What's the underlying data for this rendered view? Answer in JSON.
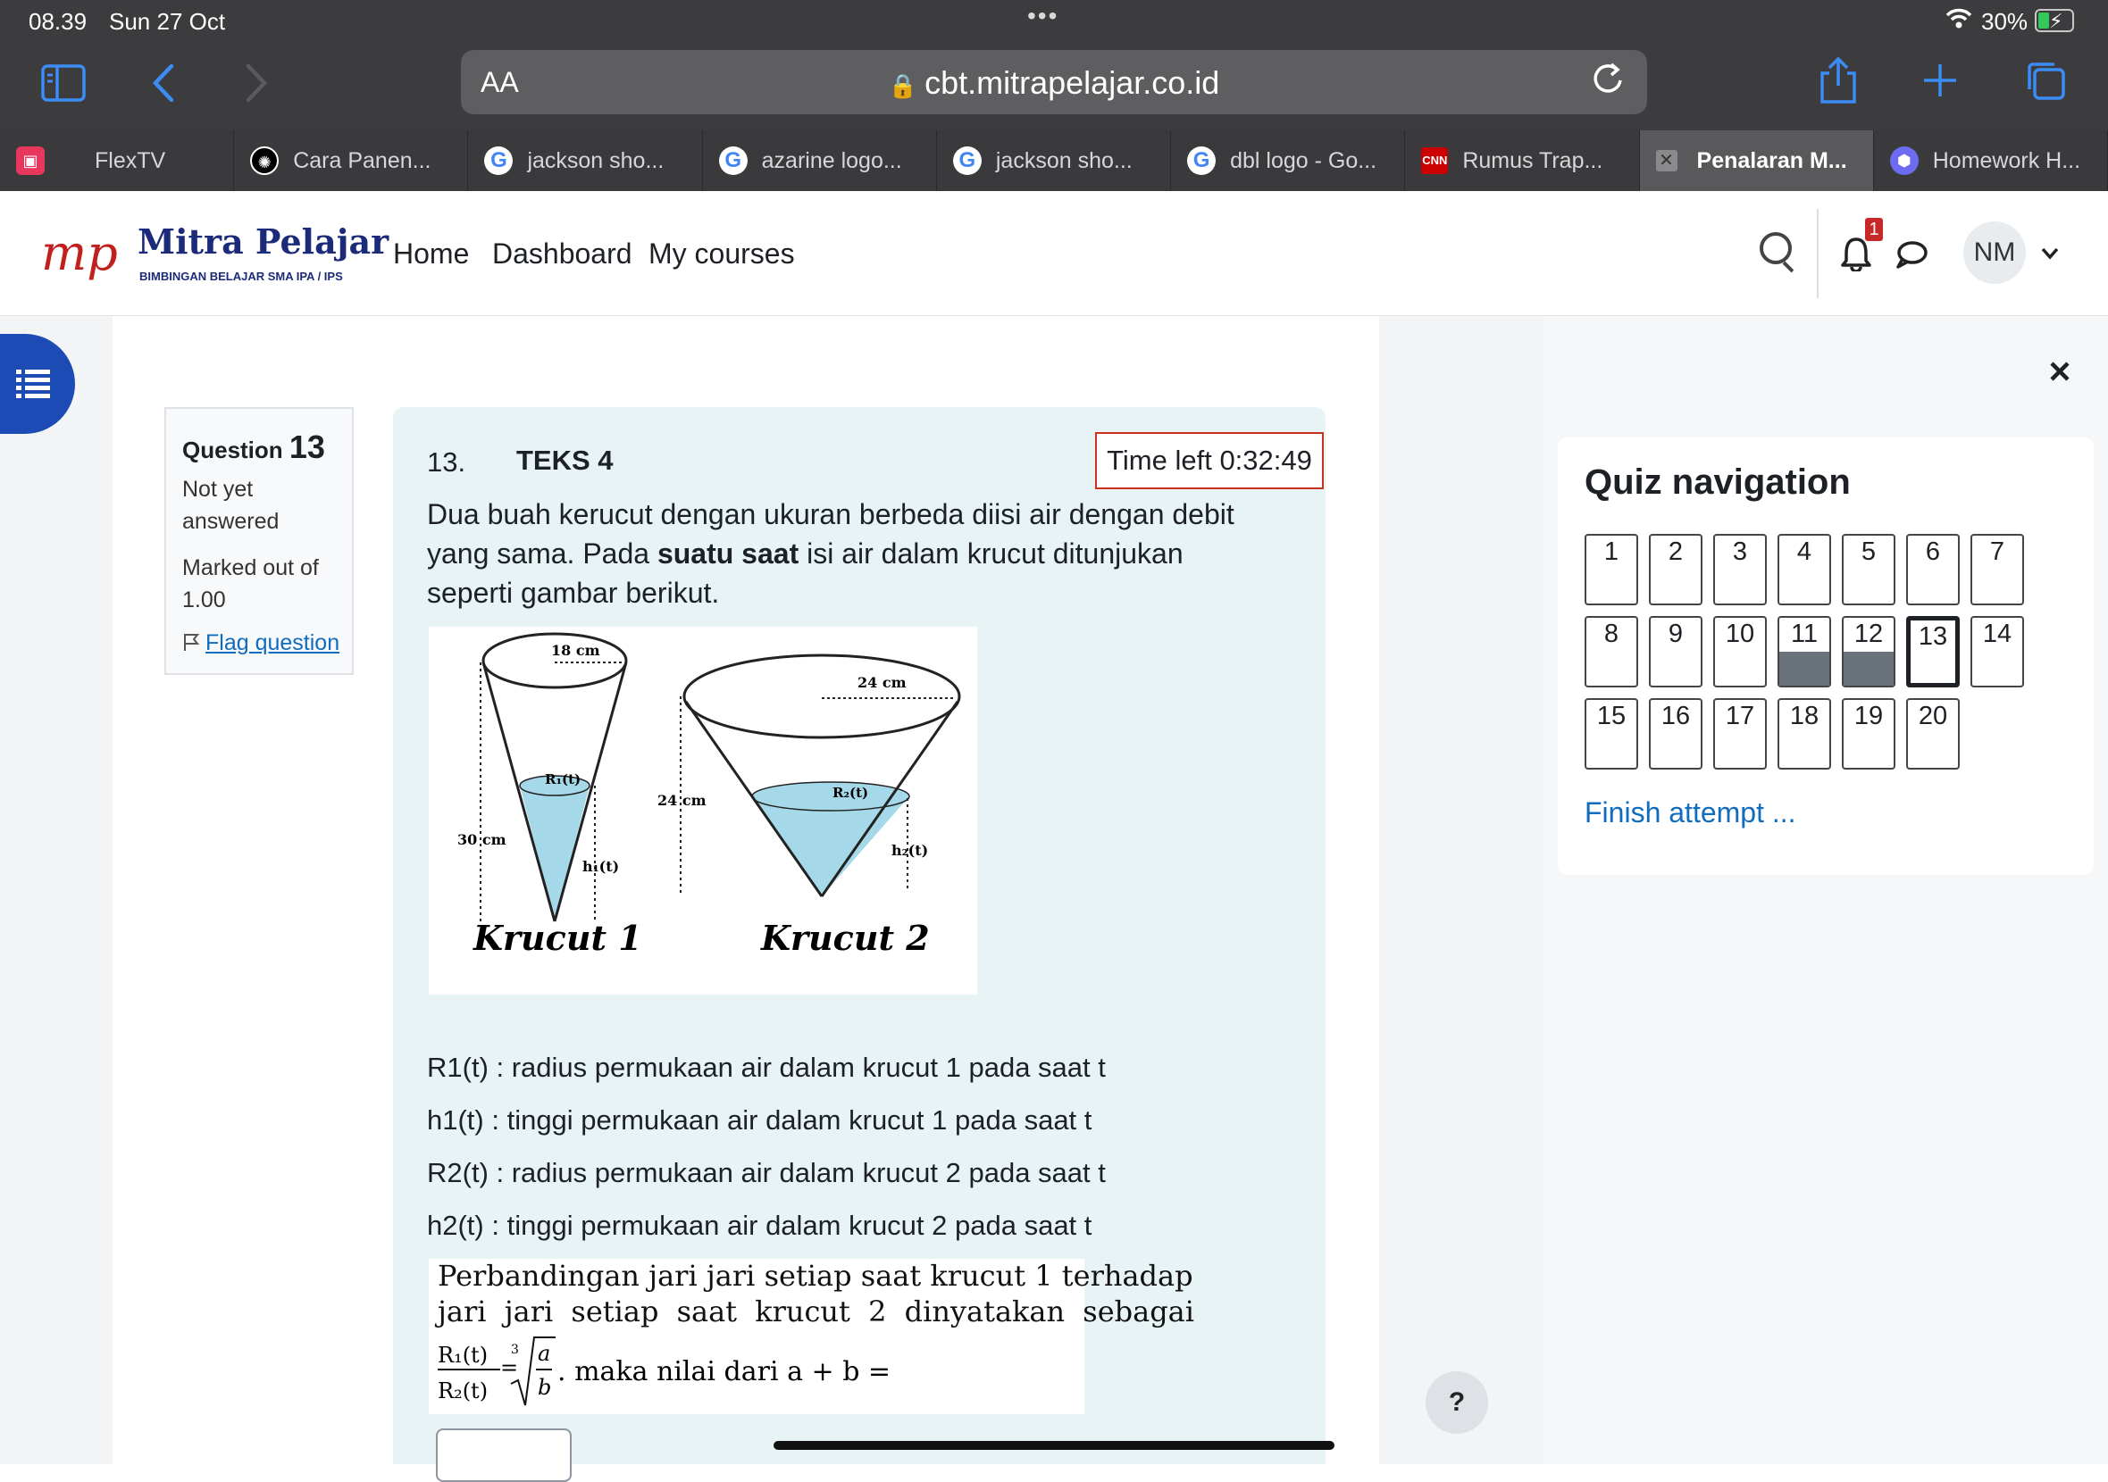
{
  "status_bar": {
    "time": "08.39",
    "date": "Sun 27 Oct",
    "battery": "30%"
  },
  "browser": {
    "text_size_label": "AA",
    "url": "cbt.mitrapelajar.co.id"
  },
  "tabs": [
    {
      "label": "FlexTV",
      "icon": "flextv-icon"
    },
    {
      "label": "Cara Panen...",
      "icon": "chatgpt-icon"
    },
    {
      "label": "jackson sho...",
      "icon": "google-icon"
    },
    {
      "label": "azarine logo...",
      "icon": "google-icon"
    },
    {
      "label": "jackson sho...",
      "icon": "google-icon"
    },
    {
      "label": "dbl logo - Go...",
      "icon": "google-icon"
    },
    {
      "label": "Rumus Trap...",
      "icon": "cnn-icon"
    },
    {
      "label": "Penalaran M...",
      "icon": "close-icon",
      "active": true
    },
    {
      "label": "Homework H...",
      "icon": "gemini-icon"
    }
  ],
  "site": {
    "logo_mark": "mp",
    "logo_name": "Mitra Pelajar",
    "logo_tagline": "BIMBINGAN BELAJAR SMA IPA / IPS",
    "nav": [
      "Home",
      "Dashboard",
      "My courses"
    ],
    "notification_count": "1",
    "user_initials": "NM"
  },
  "question_info": {
    "label": "Question",
    "number": "13",
    "status": "Not yet answered",
    "marked": "Marked out of 1.00",
    "flag": "Flag question"
  },
  "question": {
    "number": "13.",
    "title": "TEKS 4",
    "timer": "Time left 0:32:49",
    "text_pre": "Dua buah kerucut dengan ukuran berbeda diisi air dengan debit yang sama. Pada ",
    "text_bold": "suatu saat",
    "text_post": " isi air dalam krucut ditunjukan seperti gambar berikut.",
    "figure": {
      "c1_top": "18 cm",
      "c1_height": "30 cm",
      "c1_r": "R₁(t)",
      "c1_h": "h₁(t)",
      "c1_name": "Krucut 1",
      "c2_top": "24 cm",
      "c2_height": "24 cm",
      "c2_r": "R₂(t)",
      "c2_h": "h₂(t)",
      "c2_name": "Krucut 2"
    },
    "definitions": [
      "R1(t) : radius permukaan air dalam krucut 1 pada saat t",
      "h1(t) : tinggi permukaan air dalam krucut 1 pada saat t",
      "R2(t) : radius permukaan air dalam krucut 2 pada saat t",
      "h2(t) : tinggi permukaan air dalam krucut 2 pada saat t"
    ],
    "eq_line1": "Perbandingan jari jari setiap saat krucut 1 terhadap",
    "eq_line2": "jari jari setiap saat krucut 2 dinyatakan sebagai",
    "eq_num": "R₁(t)",
    "eq_den": "R₂(t)",
    "eq_root_index": "3",
    "eq_a": "a",
    "eq_b": "b",
    "eq_tail": ". maka nilai dari a + b = ⋯"
  },
  "quiz_nav": {
    "title": "Quiz navigation",
    "questions": [
      {
        "n": "1"
      },
      {
        "n": "2"
      },
      {
        "n": "3"
      },
      {
        "n": "4"
      },
      {
        "n": "5"
      },
      {
        "n": "6"
      },
      {
        "n": "7"
      },
      {
        "n": "8"
      },
      {
        "n": "9"
      },
      {
        "n": "10"
      },
      {
        "n": "11",
        "answered": true
      },
      {
        "n": "12",
        "answered": true
      },
      {
        "n": "13",
        "current": true
      },
      {
        "n": "14"
      },
      {
        "n": "15"
      },
      {
        "n": "16"
      },
      {
        "n": "17"
      },
      {
        "n": "18"
      },
      {
        "n": "19"
      },
      {
        "n": "20"
      }
    ],
    "finish": "Finish attempt ..."
  },
  "help_label": "?",
  "colors": {
    "accent": "#0f6cbf",
    "drawer": "#1c4bb5",
    "timer_border": "#ca3120",
    "question_bg": "#e7f3f5",
    "answered_fill": "#6a737b"
  }
}
